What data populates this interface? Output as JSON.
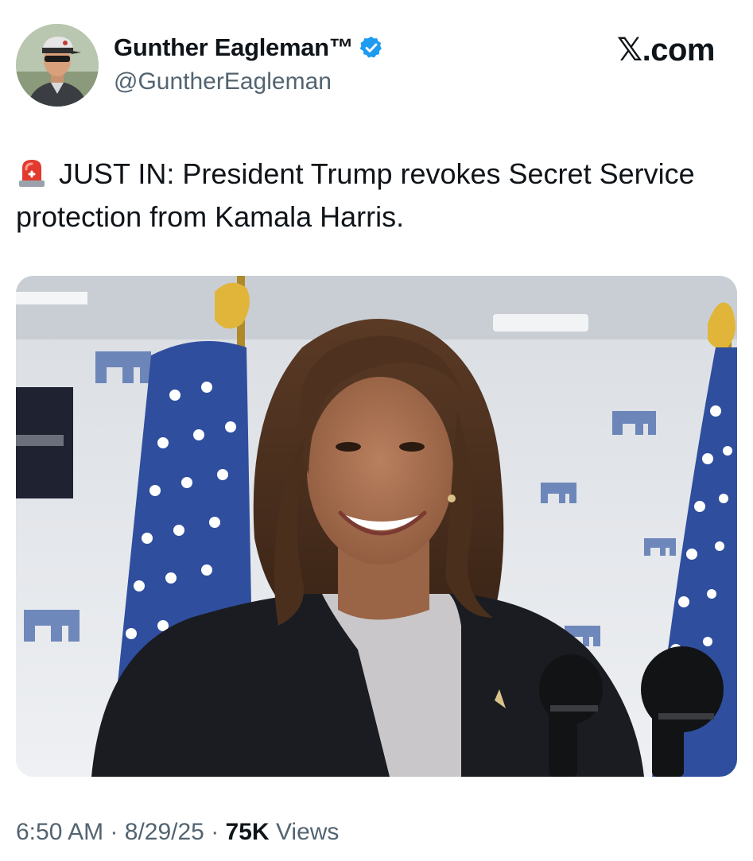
{
  "header": {
    "display_name": "Gunther Eagleman™",
    "handle": "@GuntherEagleman",
    "site_logo_text": "𝕏.com",
    "verified_badge_color": "#1d9bf0"
  },
  "tweet": {
    "text": "JUST IN: President Trump revokes Secret Service protection from Kamala Harris.",
    "emoji_icon": "police-siren-icon"
  },
  "meta": {
    "time": "6:50 AM",
    "date": "8/29/25",
    "views_count": "75K",
    "views_label": "Views",
    "separator": "·"
  },
  "colors": {
    "text_primary": "#0f1419",
    "text_secondary": "#536471",
    "accent": "#1d9bf0"
  }
}
